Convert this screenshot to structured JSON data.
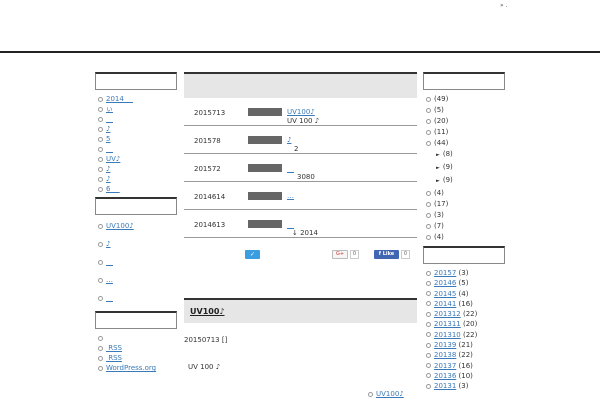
{
  "header": {
    "top_mark": "» ."
  },
  "left_sidebar": {
    "list1": [
      "2014 　",
      "ぃ",
      "　",
      "♪",
      "5",
      "　",
      "UV♪",
      "♪",
      "♪",
      "6 　"
    ],
    "list2": [
      "UV100♪",
      "♪",
      "　",
      "…",
      "　"
    ],
    "list3": [
      "",
      " RSS",
      " RSS",
      "WordPress.org"
    ]
  },
  "main": {
    "posts": [
      {
        "date": "2015713",
        "title": "UV100♪",
        "sub": "UV 100 ♪"
      },
      {
        "date": "201578",
        "title": "♪",
        "sub": "2"
      },
      {
        "date": "201572",
        "title": "　",
        "sub": "3080"
      },
      {
        "date": "2014614",
        "title": "…",
        "sub": ""
      },
      {
        "date": "2014613",
        "title": "　",
        "sub": "↓ 2014"
      }
    ],
    "social": {
      "tweet": "✓",
      "gplus": "G+",
      "gplus_count": "0",
      "fb_like": "f Like",
      "fb_count": "0"
    },
    "article": {
      "title": "UV100♪",
      "date": "20150713 []",
      "text": "UV 100 ♪",
      "link": "UV100♪"
    }
  },
  "right_sidebar": {
    "categories": [
      {
        "label": "(49)",
        "sub": false
      },
      {
        "label": "(5)",
        "sub": false
      },
      {
        "label": "(20)",
        "sub": false
      },
      {
        "label": "(11)",
        "sub": false
      },
      {
        "label": "(44)",
        "sub": false
      },
      {
        "label": "(8)",
        "sub": true
      },
      {
        "label": "(9)",
        "sub": true
      },
      {
        "label": "(9)",
        "sub": true
      },
      {
        "label": "(4)",
        "sub": false
      },
      {
        "label": "(17)",
        "sub": false
      },
      {
        "label": "(3)",
        "sub": false
      },
      {
        "label": "(7)",
        "sub": false
      },
      {
        "label": "(4)",
        "sub": false
      }
    ],
    "archives": [
      {
        "month": "20157",
        "count": "(3)"
      },
      {
        "month": "20146",
        "count": "(5)"
      },
      {
        "month": "20145",
        "count": "(4)"
      },
      {
        "month": "20141",
        "count": "(16)"
      },
      {
        "month": "201312",
        "count": "(22)"
      },
      {
        "month": "201311",
        "count": "(20)"
      },
      {
        "month": "201310",
        "count": "(22)"
      },
      {
        "month": "20139",
        "count": "(21)"
      },
      {
        "month": "20138",
        "count": "(22)"
      },
      {
        "month": "20137",
        "count": "(16)"
      },
      {
        "month": "20136",
        "count": "(10)"
      },
      {
        "month": "20131",
        "count": "(3)"
      }
    ]
  },
  "colors": {
    "link": "#3a7ab8",
    "rule": "#222222",
    "thumb": "#666666",
    "twitter": "#3a9ee0",
    "facebook": "#4267b2"
  }
}
